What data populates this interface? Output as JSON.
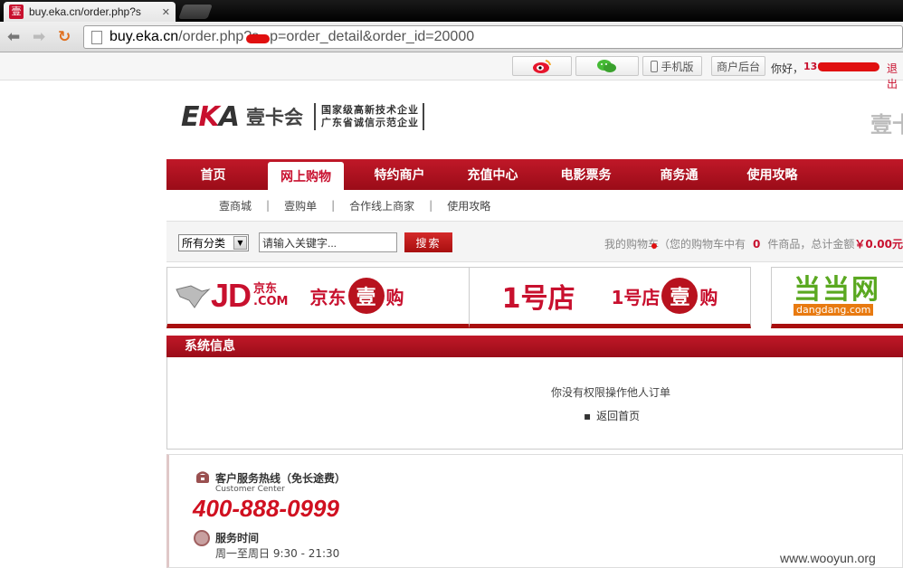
{
  "browser": {
    "tab_title": "buy.eka.cn/order.php?s",
    "tab_favicon": "壹",
    "url_host": "buy.eka.cn",
    "url_rest_1": "/order.php?s",
    "url_rest_2": "p=order_detail&order_id=20000"
  },
  "userbar": {
    "mobile_label": "手机版",
    "merchant_label": "商户后台",
    "greeting": "你好，",
    "phone_prefix": "136",
    "logout": "退出"
  },
  "header": {
    "logo_e": "E",
    "logo_k": "K",
    "logo_a": "A",
    "logo_name": "壹卡会",
    "tag1": "国家级高新技术企业",
    "tag2": "广东省诚信示范企业",
    "right_text": "壹卡"
  },
  "mainnav": [
    "首页",
    "网上购物",
    "特约商户",
    "充值中心",
    "电影票务",
    "商务通",
    "使用攻略"
  ],
  "subnav": [
    "壹商城",
    "壹购单",
    "合作线上商家",
    "使用攻略"
  ],
  "subnav_sep": "|",
  "search": {
    "category": "所有分类",
    "placeholder": "请输入关键字...",
    "button": "搜索"
  },
  "cart": {
    "prefix": "我的购物车（您的购物车中有",
    "count": "0",
    "middle": "件商品，总计金额",
    "amount": "￥0.00元"
  },
  "partners": {
    "jd_logo": "JD",
    "jd_com_1": "京东",
    "jd_com_2": ".COM",
    "jd_text": "京东",
    "jd_gou": "购",
    "yhd_logo": "1号店",
    "yhd_text": "1号店",
    "yhd_gou": "购",
    "yi": "壹",
    "dd_logo": "当当网",
    "dd_sub": "dangdang.com"
  },
  "sysinfo": {
    "title": "系统信息",
    "message": "你没有权限操作他人订单",
    "back_link": "返回首页",
    "bullet": "▪"
  },
  "service": {
    "hotline_title": "客户服务热线（免长途费）",
    "hotline_sub": "Customer Center",
    "phone": "400-888-0999",
    "hours_title": "服务时间",
    "hours": "周一至周日   9:30 - 21:30"
  },
  "watermark": "www.wooyun.org",
  "colors": {
    "brand_red": "#c8102e",
    "nav_red": "#a80f0f"
  }
}
